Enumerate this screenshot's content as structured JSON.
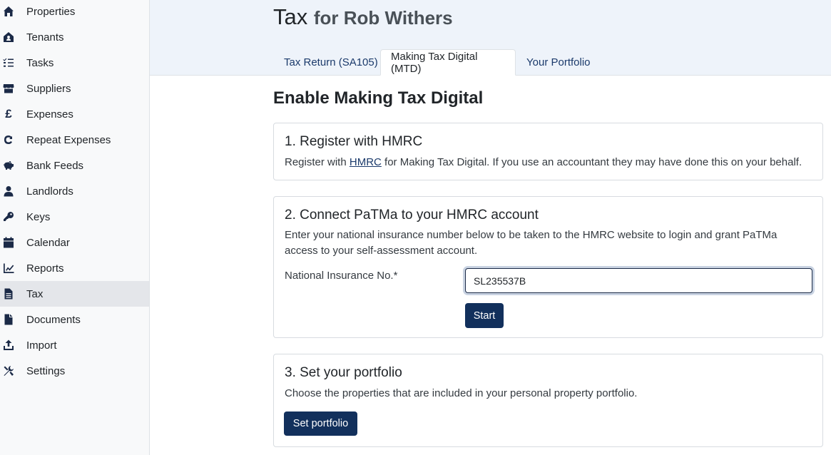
{
  "sidebar": {
    "items": [
      {
        "label": "Properties",
        "icon": "home-icon"
      },
      {
        "label": "Tenants",
        "icon": "tenant-house-icon"
      },
      {
        "label": "Tasks",
        "icon": "checklist-icon"
      },
      {
        "label": "Suppliers",
        "icon": "store-icon"
      },
      {
        "label": "Expenses",
        "icon": "pound-icon"
      },
      {
        "label": "Repeat Expenses",
        "icon": "repeat-icon"
      },
      {
        "label": "Bank Feeds",
        "icon": "piggy-bank-icon"
      },
      {
        "label": "Landlords",
        "icon": "user-icon"
      },
      {
        "label": "Keys",
        "icon": "key-icon"
      },
      {
        "label": "Calendar",
        "icon": "calendar-icon"
      },
      {
        "label": "Reports",
        "icon": "chart-icon"
      },
      {
        "label": "Tax",
        "icon": "document-icon"
      },
      {
        "label": "Documents",
        "icon": "file-icon"
      },
      {
        "label": "Import",
        "icon": "upload-icon"
      },
      {
        "label": "Settings",
        "icon": "tools-icon"
      }
    ],
    "active": "Tax"
  },
  "header": {
    "title": "Tax",
    "subtitle": "for Rob Withers"
  },
  "tabs": [
    {
      "label": "Tax Return (SA105)"
    },
    {
      "label": "Making Tax Digital (MTD)"
    },
    {
      "label": "Your Portfolio"
    }
  ],
  "main": {
    "heading": "Enable Making Tax Digital",
    "step1": {
      "title": "1. Register with HMRC",
      "text_before": "Register with ",
      "link": "HMRC",
      "text_after": " for Making Tax Digital. If you use an accountant they may have done this on your behalf."
    },
    "step2": {
      "title": "2. Connect PaTMa to your HMRC account",
      "text": "Enter your national insurance number below to be taken to the HMRC website to login and grant PaTMa access to your self-assessment account.",
      "ni_label": "National Insurance No.*",
      "ni_value": "SL235537B",
      "start_label": "Start"
    },
    "step3": {
      "title": "3. Set your portfolio",
      "text": "Choose the properties that are included in your personal property portfolio.",
      "button_label": "Set portfolio"
    }
  },
  "colors": {
    "primary": "#12305c",
    "header_bg": "#eef3fa",
    "sidebar_bg": "#f8f9fa",
    "active_nav": "#e4e6ea"
  }
}
